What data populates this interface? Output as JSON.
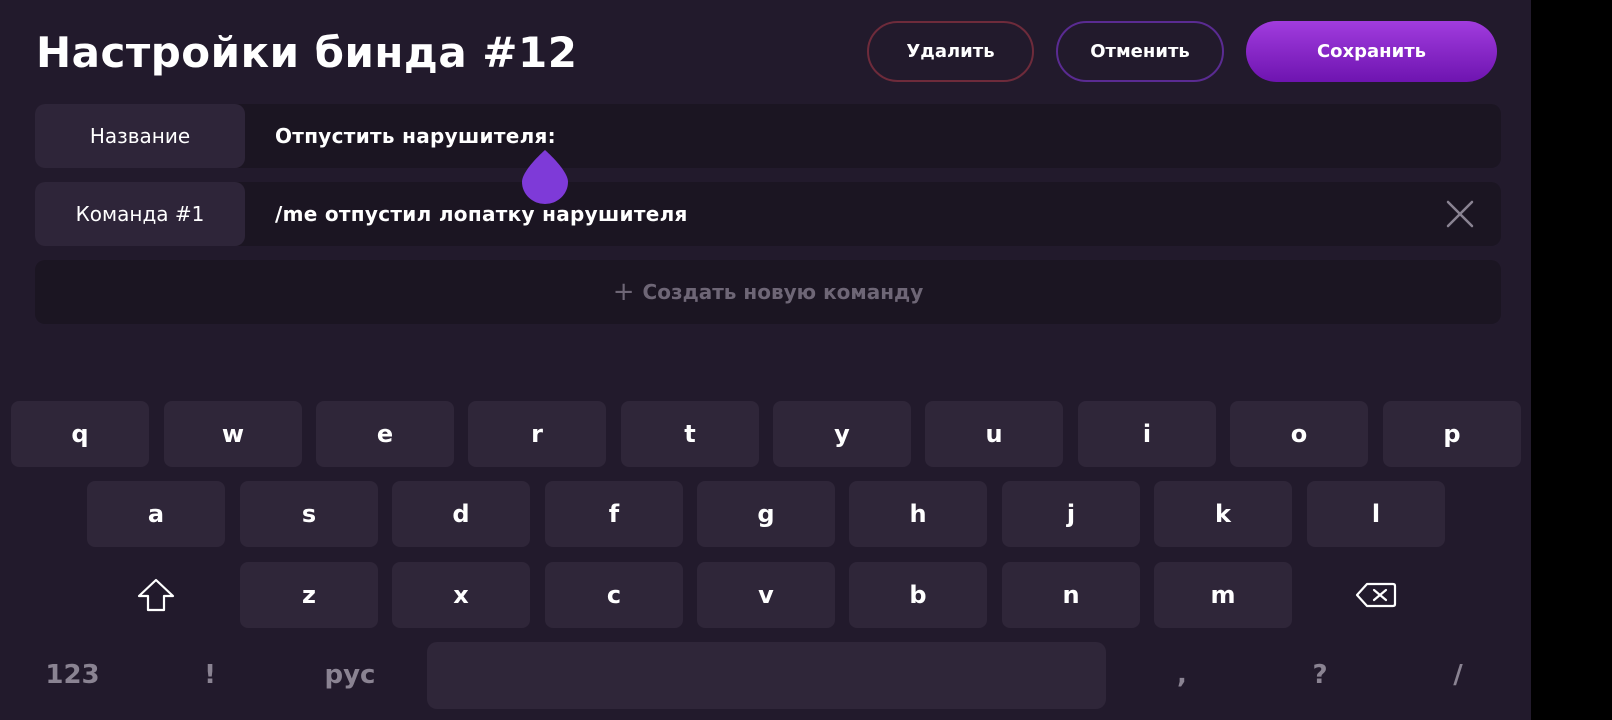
{
  "header": {
    "title": "Настройки бинда #12",
    "delete_label": "Удалить",
    "cancel_label": "Отменить",
    "save_label": "Сохранить"
  },
  "fields": {
    "name_label": "Название",
    "name_value": "Отпустить нарушителя:",
    "command_label": "Команда #1",
    "command_value": "/me отпустил лопатку нарушителя",
    "add_command_label": "Создать новую команду"
  },
  "keyboard": {
    "row1": [
      "q",
      "w",
      "e",
      "r",
      "t",
      "y",
      "u",
      "i",
      "o",
      "p"
    ],
    "row2": [
      "a",
      "s",
      "d",
      "f",
      "g",
      "h",
      "j",
      "k",
      "l"
    ],
    "row3": [
      "z",
      "x",
      "c",
      "v",
      "b",
      "n",
      "m"
    ],
    "numbers_key": "123",
    "exclaim_key": "!",
    "lang_key": "рус",
    "comma_key": ",",
    "question_key": "?",
    "slash_key": "/"
  },
  "colors": {
    "background": "#221a2c",
    "accent": "#8a2be2",
    "delete_border": "#6e2b3b",
    "cancel_border": "#5a2b92"
  }
}
